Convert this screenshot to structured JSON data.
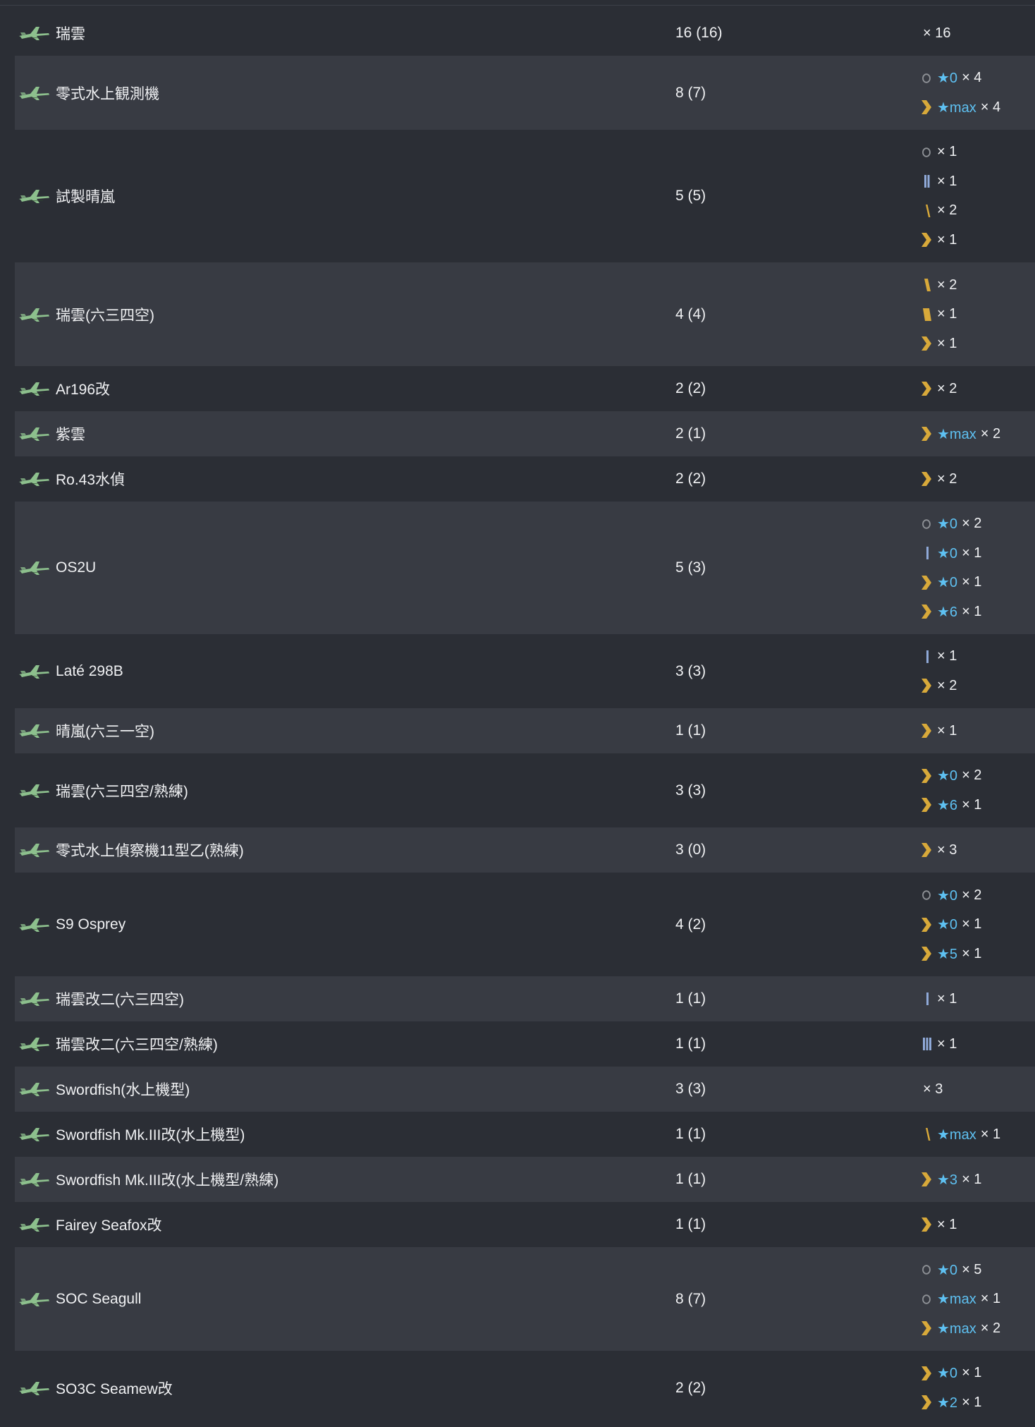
{
  "icons": {
    "plane_color": "#8dc08d",
    "ring_color": "#8e9196",
    "blue_color": "#8fa9d8",
    "gold_color": "#d8a93a",
    "star_color": "#5ec1f2"
  },
  "rows": [
    {
      "name": "瑞雲",
      "count": "16 (16)",
      "profs": [
        {
          "icon": "",
          "star": "",
          "mult": "× 16"
        }
      ]
    },
    {
      "name": "零式水上観測機",
      "count": "8 (7)",
      "profs": [
        {
          "icon": "ring",
          "star": "★0",
          "mult": "× 4"
        },
        {
          "icon": "chevron",
          "star": "★max",
          "mult": "× 4"
        }
      ]
    },
    {
      "name": "試製晴嵐",
      "count": "5 (5)",
      "profs": [
        {
          "icon": "ring",
          "star": "",
          "mult": "× 1"
        },
        {
          "icon": "bar2",
          "star": "",
          "mult": "× 1"
        },
        {
          "icon": "slash1",
          "star": "",
          "mult": "× 2"
        },
        {
          "icon": "chevron",
          "star": "",
          "mult": "× 1"
        }
      ]
    },
    {
      "name": "瑞雲(六三四空)",
      "count": "4 (4)",
      "profs": [
        {
          "icon": "slash2",
          "star": "",
          "mult": "× 2"
        },
        {
          "icon": "slash3",
          "star": "",
          "mult": "× 1"
        },
        {
          "icon": "chevron",
          "star": "",
          "mult": "× 1"
        }
      ]
    },
    {
      "name": "Ar196改",
      "count": "2 (2)",
      "profs": [
        {
          "icon": "chevron",
          "star": "",
          "mult": "× 2"
        }
      ]
    },
    {
      "name": "紫雲",
      "count": "2 (1)",
      "profs": [
        {
          "icon": "chevron",
          "star": "★max",
          "mult": "× 2"
        }
      ]
    },
    {
      "name": "Ro.43水偵",
      "count": "2 (2)",
      "profs": [
        {
          "icon": "chevron",
          "star": "",
          "mult": "× 2"
        }
      ]
    },
    {
      "name": "OS2U",
      "count": "5 (3)",
      "profs": [
        {
          "icon": "ring",
          "star": "★0",
          "mult": "× 2"
        },
        {
          "icon": "bar1",
          "star": "★0",
          "mult": "× 1"
        },
        {
          "icon": "chevron",
          "star": "★0",
          "mult": "× 1"
        },
        {
          "icon": "chevron",
          "star": "★6",
          "mult": "× 1"
        }
      ]
    },
    {
      "name": "Laté 298B",
      "count": "3 (3)",
      "profs": [
        {
          "icon": "bar1",
          "star": "",
          "mult": "× 1"
        },
        {
          "icon": "chevron",
          "star": "",
          "mult": "× 2"
        }
      ]
    },
    {
      "name": "晴嵐(六三一空)",
      "count": "1 (1)",
      "profs": [
        {
          "icon": "chevron",
          "star": "",
          "mult": "× 1"
        }
      ]
    },
    {
      "name": "瑞雲(六三四空/熟練)",
      "count": "3 (3)",
      "profs": [
        {
          "icon": "chevron",
          "star": "★0",
          "mult": "× 2"
        },
        {
          "icon": "chevron",
          "star": "★6",
          "mult": "× 1"
        }
      ]
    },
    {
      "name": "零式水上偵察機11型乙(熟練)",
      "count": "3 (0)",
      "profs": [
        {
          "icon": "chevron",
          "star": "",
          "mult": "× 3"
        }
      ]
    },
    {
      "name": "S9 Osprey",
      "count": "4 (2)",
      "profs": [
        {
          "icon": "ring",
          "star": "★0",
          "mult": "× 2"
        },
        {
          "icon": "chevron",
          "star": "★0",
          "mult": "× 1"
        },
        {
          "icon": "chevron",
          "star": "★5",
          "mult": "× 1"
        }
      ]
    },
    {
      "name": "瑞雲改二(六三四空)",
      "count": "1 (1)",
      "profs": [
        {
          "icon": "bar1",
          "star": "",
          "mult": "× 1"
        }
      ]
    },
    {
      "name": "瑞雲改二(六三四空/熟練)",
      "count": "1 (1)",
      "profs": [
        {
          "icon": "bar3",
          "star": "",
          "mult": "× 1"
        }
      ]
    },
    {
      "name": "Swordfish(水上機型)",
      "count": "3 (3)",
      "profs": [
        {
          "icon": "",
          "star": "",
          "mult": "× 3"
        }
      ]
    },
    {
      "name": "Swordfish Mk.III改(水上機型)",
      "count": "1 (1)",
      "profs": [
        {
          "icon": "slash1",
          "star": "★max",
          "mult": "× 1"
        }
      ]
    },
    {
      "name": "Swordfish Mk.III改(水上機型/熟練)",
      "count": "1 (1)",
      "profs": [
        {
          "icon": "chevron",
          "star": "★3",
          "mult": "× 1"
        }
      ]
    },
    {
      "name": "Fairey Seafox改",
      "count": "1 (1)",
      "profs": [
        {
          "icon": "chevron",
          "star": "",
          "mult": "× 1"
        }
      ]
    },
    {
      "name": "SOC Seagull",
      "count": "8 (7)",
      "profs": [
        {
          "icon": "ring",
          "star": "★0",
          "mult": "× 5"
        },
        {
          "icon": "ring",
          "star": "★max",
          "mult": "× 1"
        },
        {
          "icon": "chevron",
          "star": "★max",
          "mult": "× 2"
        }
      ]
    },
    {
      "name": "SO3C Seamew改",
      "count": "2 (2)",
      "profs": [
        {
          "icon": "chevron",
          "star": "★0",
          "mult": "× 1"
        },
        {
          "icon": "chevron",
          "star": "★2",
          "mult": "× 1"
        }
      ]
    }
  ]
}
